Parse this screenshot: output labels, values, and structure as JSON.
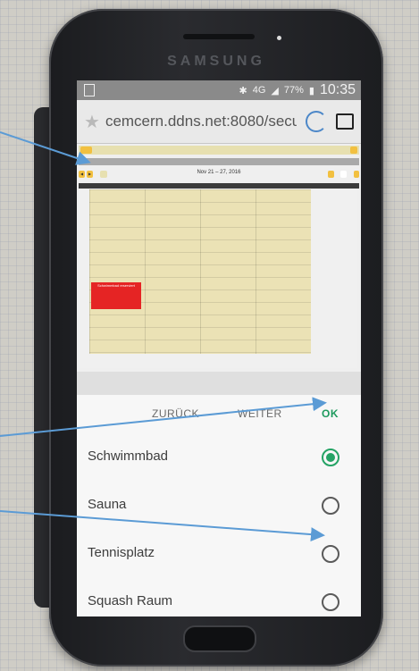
{
  "device": {
    "brand": "SAMSUNG"
  },
  "status_bar": {
    "network": "4G",
    "battery": "77%",
    "time": "10:35"
  },
  "browser": {
    "url": "cemcern.ddns.net:8080/secu"
  },
  "calendar_page": {
    "date_range": "Nov 21 – 27, 2016",
    "event_text": "Schwimmbad reserviert"
  },
  "dialog": {
    "buttons": {
      "back": "ZURÜCK",
      "next": "WEITER",
      "ok": "OK"
    },
    "options": [
      {
        "label": "Schwimmbad",
        "selected": true
      },
      {
        "label": "Sauna",
        "selected": false
      },
      {
        "label": "Tennisplatz",
        "selected": false
      },
      {
        "label": "Squash Raum",
        "selected": false
      }
    ]
  },
  "colors": {
    "accent_green": "#25a365",
    "arrow_blue": "#5b9bd5",
    "event_red": "#e52424"
  }
}
